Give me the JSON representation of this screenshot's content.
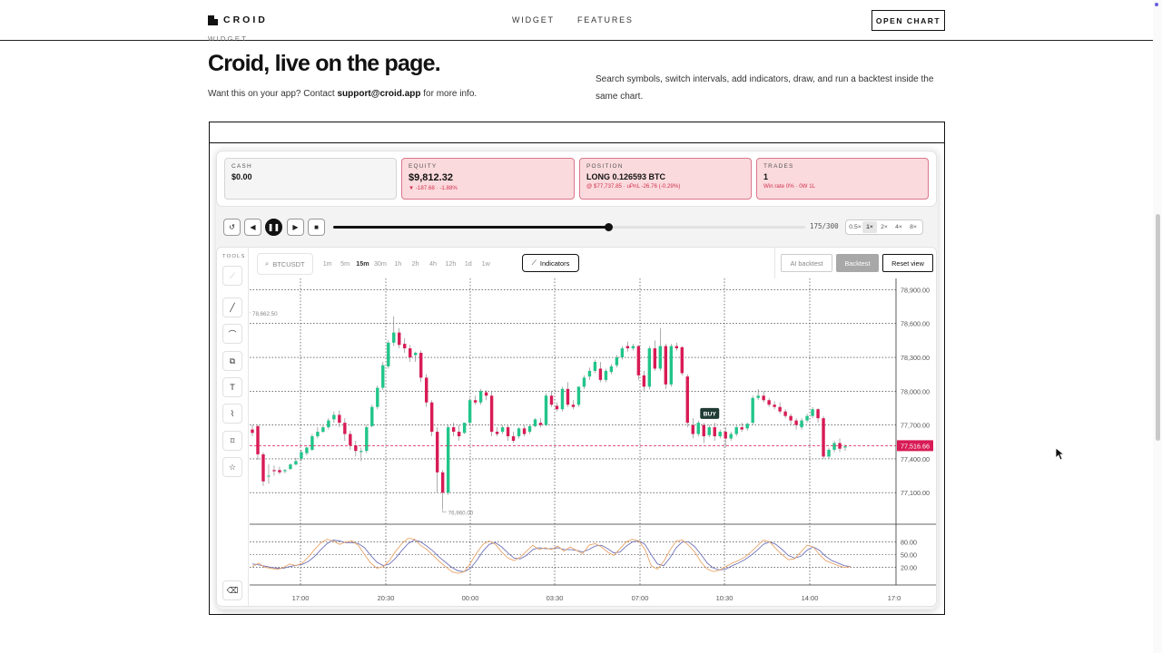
{
  "nav": {
    "logo": "CROID",
    "links": [
      "WIDGET",
      "FEATURES"
    ],
    "cta": "OPEN CHART"
  },
  "hero": {
    "eyebrow": "WIDGET",
    "title": "Croid, live on the page.",
    "subtitle_prefix": "Want this on your app? Contact ",
    "subtitle_email": "support@croid.app",
    "subtitle_suffix": " for more info.",
    "description": "Search symbols, switch intervals, add indicators, draw, and run a backtest inside the same chart."
  },
  "stats": {
    "cash": {
      "label": "CASH",
      "value": "$0.00"
    },
    "equity": {
      "label": "EQUITY",
      "value": "$9,812.32",
      "sub": "▼ -187.68 · -1.88%"
    },
    "position": {
      "label": "POSITION",
      "value": "LONG 0.126593 BTC",
      "sub": "@ $77,737.85 · uPnL -26.76 (-0.29%)"
    },
    "trades": {
      "label": "TRADES",
      "value": "1",
      "sub": "Win rate 0% · 0W 1L"
    }
  },
  "player": {
    "progress": 0.583,
    "frame_count": "175/300",
    "speeds": [
      "0.5×",
      "1×",
      "2×",
      "4×",
      "8×"
    ],
    "active_speed": "1×",
    "buttons": [
      "reset",
      "step-back",
      "pause",
      "step-forward",
      "stop"
    ]
  },
  "tools": {
    "label": "TOOLS",
    "items": [
      "cursor-line",
      "trend-line",
      "channel",
      "shapes",
      "text",
      "path",
      "measure",
      "favorites",
      "trash"
    ]
  },
  "toolbar": {
    "symbol": "BTCUSDT",
    "intervals": [
      "1m",
      "5m",
      "15m",
      "30m",
      "1h",
      "2h",
      "4h",
      "12h",
      "1d",
      "1w"
    ],
    "active_interval": "15m",
    "indicators_label": "Indicators",
    "ai_backtest": "AI backtest",
    "backtest": "Backtest",
    "reset_view": "Reset view"
  },
  "chart_data": {
    "type": "candlestick",
    "symbol": "BTCUSDT",
    "interval": "15m",
    "price_ticks": [
      "78,900.00",
      "78,600.00",
      "78,300.00",
      "78,000.00",
      "77,700.00",
      "77,400.00",
      "77,100.00"
    ],
    "price_tick_values": [
      78900,
      78600,
      78300,
      78000,
      77700,
      77400,
      77100
    ],
    "ylim": [
      76820,
      79000
    ],
    "time_ticks": [
      "17:00",
      "20:30",
      "00:00",
      "03:30",
      "07:00",
      "10:30",
      "14:00",
      "17:0"
    ],
    "last_price_label": "77,516.66",
    "last_price": 77516.66,
    "high_label": "78,662.50",
    "high": 78662.5,
    "low_label": "76,960.00",
    "low": 76960,
    "annotations": [
      "BUY"
    ],
    "buy_price": 77737.85,
    "candles": [
      [
        77660,
        77700,
        77630,
        77600
      ],
      [
        77690,
        77700,
        77440,
        77390
      ],
      [
        77440,
        77460,
        77200,
        77160
      ],
      [
        77250,
        77350,
        77250,
        77180
      ],
      [
        77300,
        77340,
        77290,
        77250
      ],
      [
        77300,
        77330,
        77280,
        77260
      ],
      [
        77290,
        77310,
        77300,
        77270
      ],
      [
        77310,
        77360,
        77350,
        77300
      ],
      [
        77350,
        77410,
        77380,
        77340
      ],
      [
        77400,
        77480,
        77460,
        77380
      ],
      [
        77450,
        77510,
        77500,
        77430
      ],
      [
        77480,
        77620,
        77600,
        77470
      ],
      [
        77600,
        77680,
        77640,
        77580
      ],
      [
        77640,
        77700,
        77680,
        77630
      ],
      [
        77680,
        77760,
        77740,
        77660
      ],
      [
        77750,
        77820,
        77790,
        77720
      ],
      [
        77790,
        77830,
        77720,
        77680
      ],
      [
        77720,
        77760,
        77620,
        77560
      ],
      [
        77620,
        77650,
        77520,
        77480
      ],
      [
        77520,
        77560,
        77470,
        77420
      ],
      [
        77460,
        77500,
        77470,
        77380
      ],
      [
        77470,
        77700,
        77680,
        77450
      ],
      [
        77690,
        77880,
        77860,
        77680
      ],
      [
        77860,
        78050,
        78030,
        77840
      ],
      [
        78030,
        78260,
        78230,
        78010
      ],
      [
        78220,
        78450,
        78430,
        78200
      ],
      [
        78430,
        78662,
        78520,
        78400
      ],
      [
        78520,
        78560,
        78410,
        78380
      ],
      [
        78420,
        78470,
        78380,
        78340
      ],
      [
        78380,
        78410,
        78300,
        78260
      ],
      [
        78320,
        78350,
        78340,
        78260
      ],
      [
        78340,
        78360,
        78120,
        78080
      ],
      [
        78120,
        78150,
        77900,
        77860
      ],
      [
        77900,
        77920,
        77640,
        77600
      ],
      [
        77640,
        77680,
        77280,
        77100
      ],
      [
        77280,
        77300,
        77100,
        76960
      ],
      [
        77100,
        77700,
        77680,
        77080
      ],
      [
        77680,
        77720,
        77640,
        77600
      ],
      [
        77640,
        77700,
        77600,
        77560
      ],
      [
        77630,
        77720,
        77720,
        77620
      ],
      [
        77720,
        77940,
        77920,
        77700
      ],
      [
        77920,
        77960,
        77900,
        77880
      ],
      [
        77900,
        78020,
        78000,
        77880
      ],
      [
        77990,
        78010,
        77960,
        77920
      ],
      [
        77960,
        78000,
        77640,
        77600
      ],
      [
        77640,
        77680,
        77620,
        77600
      ],
      [
        77640,
        77700,
        77680,
        77620
      ],
      [
        77680,
        77700,
        77600,
        77560
      ],
      [
        77600,
        77640,
        77560,
        77540
      ],
      [
        77600,
        77680,
        77670,
        77580
      ],
      [
        77670,
        77700,
        77620,
        77600
      ],
      [
        77640,
        77700,
        77690,
        77620
      ],
      [
        77690,
        77760,
        77750,
        77680
      ],
      [
        77720,
        77760,
        77700,
        77680
      ],
      [
        77700,
        77980,
        77960,
        77690
      ],
      [
        77960,
        78000,
        77880,
        77860
      ],
      [
        77870,
        77900,
        77840,
        77820
      ],
      [
        77840,
        78040,
        78020,
        77820
      ],
      [
        78020,
        78080,
        77880,
        77860
      ],
      [
        77880,
        77920,
        77860,
        77840
      ],
      [
        77880,
        78040,
        78040,
        77860
      ],
      [
        78040,
        78140,
        78120,
        78020
      ],
      [
        78130,
        78210,
        78180,
        78100
      ],
      [
        78180,
        78280,
        78260,
        78160
      ],
      [
        78200,
        78260,
        78100,
        78080
      ],
      [
        78100,
        78200,
        78180,
        78080
      ],
      [
        78170,
        78240,
        78220,
        78150
      ],
      [
        78230,
        78320,
        78300,
        78210
      ],
      [
        78300,
        78400,
        78380,
        78280
      ],
      [
        78400,
        78440,
        78380,
        78350
      ],
      [
        78380,
        78420,
        78400,
        78360
      ],
      [
        78400,
        78410,
        78140,
        78100
      ],
      [
        78140,
        78180,
        78040,
        78000
      ],
      [
        78040,
        78400,
        78380,
        78020
      ],
      [
        78380,
        78450,
        78200,
        78180
      ],
      [
        78200,
        78560,
        78400,
        78180
      ],
      [
        78400,
        78420,
        78060,
        78020
      ],
      [
        78060,
        78420,
        78400,
        78040
      ],
      [
        78400,
        78430,
        78380,
        78360
      ],
      [
        78390,
        78400,
        78160,
        78140
      ],
      [
        78130,
        78150,
        77720,
        77680
      ],
      [
        77700,
        77760,
        77620,
        77580
      ],
      [
        77620,
        77740,
        77720,
        77600
      ],
      [
        77700,
        77720,
        77600,
        77540
      ],
      [
        77610,
        77700,
        77680,
        77590
      ],
      [
        77680,
        77720,
        77600,
        77560
      ],
      [
        77600,
        77660,
        77640,
        77580
      ],
      [
        77640,
        77680,
        77580,
        77500
      ],
      [
        77580,
        77640,
        77620,
        77560
      ],
      [
        77620,
        77700,
        77680,
        77600
      ],
      [
        77680,
        77720,
        77660,
        77640
      ],
      [
        77670,
        77720,
        77710,
        77650
      ],
      [
        77720,
        77960,
        77940,
        77700
      ],
      [
        77940,
        78020,
        77960,
        77920
      ],
      [
        77960,
        78000,
        77920,
        77900
      ],
      [
        77920,
        77940,
        77880,
        77860
      ],
      [
        77880,
        77910,
        77860,
        77840
      ],
      [
        77860,
        77900,
        77820,
        77800
      ],
      [
        77820,
        77840,
        77780,
        77760
      ],
      [
        77780,
        77800,
        77740,
        77700
      ],
      [
        77740,
        77760,
        77700,
        77660
      ],
      [
        77680,
        77760,
        77740,
        77660
      ],
      [
        77740,
        77800,
        77780,
        77720
      ],
      [
        77780,
        77860,
        77840,
        77760
      ],
      [
        77840,
        77850,
        77760,
        77720
      ],
      [
        77760,
        77780,
        77420,
        77400
      ],
      [
        77420,
        77500,
        77480,
        77400
      ],
      [
        77480,
        77560,
        77540,
        77460
      ],
      [
        77540,
        77580,
        77490,
        77460
      ],
      [
        77500,
        77530,
        77510,
        77470
      ]
    ],
    "stochastic": {
      "levels": [
        "80.00",
        "50.00",
        "20.00"
      ],
      "level_values": [
        80,
        50,
        20
      ],
      "k": [
        22,
        30,
        20,
        18,
        15,
        20,
        28,
        24,
        30,
        45,
        62,
        78,
        86,
        82,
        74,
        80,
        82,
        72,
        50,
        30,
        18,
        22,
        36,
        58,
        76,
        88,
        86,
        72,
        62,
        48,
        34,
        22,
        10,
        6,
        10,
        30,
        54,
        74,
        82,
        74,
        56,
        42,
        36,
        44,
        58,
        72,
        62,
        66,
        62,
        70,
        58,
        68,
        60,
        52,
        72,
        76,
        68,
        56,
        48,
        64,
        80,
        86,
        82,
        62,
        24,
        16,
        34,
        60,
        82,
        84,
        72,
        56,
        32,
        16,
        10,
        14,
        22,
        30,
        36,
        44,
        56,
        70,
        84,
        80,
        64,
        50,
        38,
        40,
        56,
        72,
        68,
        50,
        36,
        30,
        24,
        20,
        22
      ],
      "d": [
        28,
        26,
        23,
        20,
        18,
        18,
        22,
        25,
        27,
        34,
        46,
        62,
        76,
        84,
        82,
        78,
        78,
        76,
        66,
        48,
        32,
        24,
        28,
        42,
        60,
        76,
        84,
        80,
        70,
        58,
        44,
        32,
        20,
        12,
        10,
        18,
        36,
        58,
        74,
        78,
        68,
        54,
        42,
        40,
        48,
        62,
        66,
        64,
        64,
        66,
        62,
        62,
        60,
        56,
        62,
        70,
        72,
        64,
        54,
        56,
        70,
        80,
        82,
        74,
        50,
        28,
        24,
        42,
        66,
        80,
        80,
        68,
        50,
        30,
        18,
        14,
        16,
        24,
        30,
        38,
        48,
        60,
        74,
        80,
        74,
        62,
        48,
        42,
        46,
        60,
        68,
        60,
        46,
        36,
        30,
        24,
        22
      ]
    }
  },
  "colors": {
    "bull": "#21c58a",
    "bear": "#d81b55",
    "k_line": "#e8a56a",
    "d_line": "#6f72b8",
    "last_price_tag": "#d81b55",
    "buy_tag": "#1f3b34"
  }
}
